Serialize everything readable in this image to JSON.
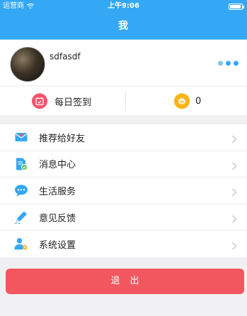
{
  "status_bar": {
    "carrier": "运营商",
    "time": "上午9:06"
  },
  "navbar": {
    "title": "我"
  },
  "profile": {
    "username": "sdfasdf"
  },
  "stats": {
    "checkin_label": "每日签到",
    "points_value": "0"
  },
  "menu": {
    "items": [
      {
        "label": "推荐给好友",
        "icon": "envelope-heart-icon",
        "color": "#34a8f4"
      },
      {
        "label": "消息中心",
        "icon": "document-check-icon",
        "color": "#34a8f4"
      },
      {
        "label": "生活服务",
        "icon": "chat-bubble-icon",
        "color": "#34a8f4"
      },
      {
        "label": "意见反馈",
        "icon": "pencil-icon",
        "color": "#34a8f4"
      },
      {
        "label": "系统设置",
        "icon": "user-settings-icon",
        "color": "#34a8f4"
      }
    ]
  },
  "logout": {
    "label": "退出"
  },
  "colors": {
    "primary": "#34a8f4",
    "checkin": "#f0556d",
    "coin": "#f6b515",
    "logout": "#f2565e"
  }
}
